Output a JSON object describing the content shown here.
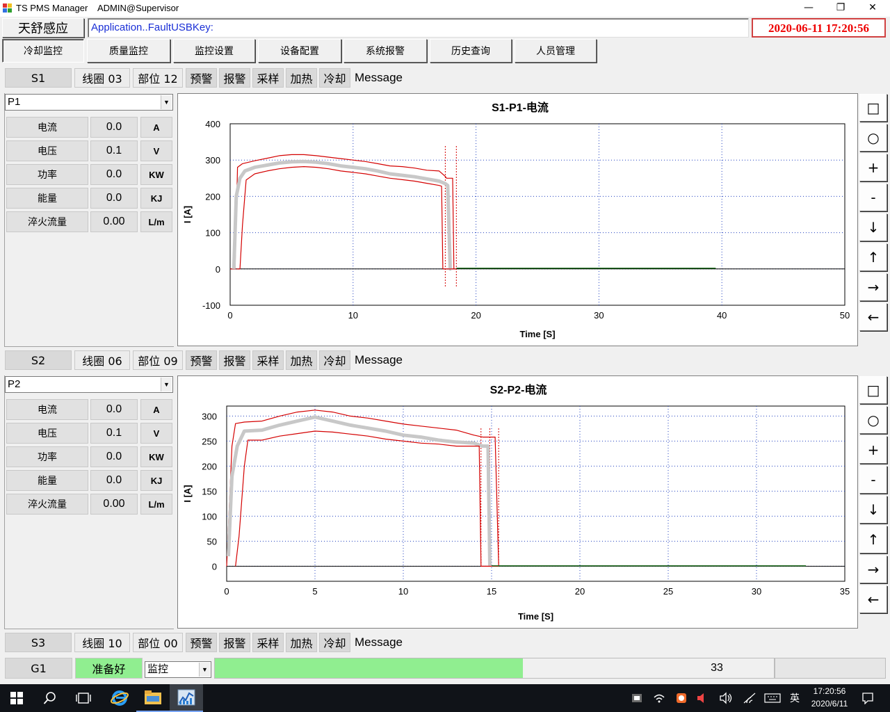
{
  "window": {
    "title": "TS PMS Manager",
    "user": "ADMIN@Supervisor",
    "minimize": "—",
    "maximize": "❐",
    "close": "✕"
  },
  "header": {
    "brand": "天舒感应",
    "status_text": "Application..FaultUSBKey:",
    "datetime": "2020-06-11 17:20:56"
  },
  "tabs": [
    {
      "label": "冷却监控",
      "active": true
    },
    {
      "label": "质量监控",
      "active": false
    },
    {
      "label": "监控设置",
      "active": false
    },
    {
      "label": "设备配置",
      "active": false
    },
    {
      "label": "系统报警",
      "active": false
    },
    {
      "label": "历史查询",
      "active": false
    },
    {
      "label": "人员管理",
      "active": false
    }
  ],
  "stations": [
    {
      "station": "S1",
      "coil": "线圈 03",
      "part": "部位 12",
      "flags": [
        "预警",
        "报警",
        "采样",
        "加热",
        "冷却"
      ],
      "message": "Message",
      "selected_point": "P1",
      "metrics": [
        {
          "label": "电流",
          "value": "0.0",
          "unit": "A"
        },
        {
          "label": "电压",
          "value": "0.1",
          "unit": "V"
        },
        {
          "label": "功率",
          "value": "0.0",
          "unit": "KW"
        },
        {
          "label": "能量",
          "value": "0.0",
          "unit": "KJ"
        },
        {
          "label": "淬火流量",
          "value": "0.00",
          "unit": "L/m"
        }
      ]
    },
    {
      "station": "S2",
      "coil": "线圈 06",
      "part": "部位 09",
      "flags": [
        "预警",
        "报警",
        "采样",
        "加热",
        "冷却"
      ],
      "message": "Message",
      "selected_point": "P2",
      "metrics": [
        {
          "label": "电流",
          "value": "0.0",
          "unit": "A"
        },
        {
          "label": "电压",
          "value": "0.1",
          "unit": "V"
        },
        {
          "label": "功率",
          "value": "0.0",
          "unit": "KW"
        },
        {
          "label": "能量",
          "value": "0.0",
          "unit": "KJ"
        },
        {
          "label": "淬火流量",
          "value": "0.00",
          "unit": "L/m"
        }
      ]
    },
    {
      "station": "S3",
      "coil": "线圈 10",
      "part": "部位 00",
      "flags": [
        "预警",
        "报警",
        "采样",
        "加热",
        "冷却"
      ],
      "message": "Message"
    }
  ],
  "chart_tools": [
    "□",
    "○",
    "+",
    "-",
    "↓",
    "↑",
    "→",
    "←"
  ],
  "chart_tool_icons": [
    "square-icon",
    "circle-icon",
    "plus-icon",
    "minus-icon",
    "arrow-down-icon",
    "arrow-up-icon",
    "arrow-right-icon",
    "arrow-left-icon"
  ],
  "colors": {
    "limit_line": "#d40000",
    "measured_line": "#c8c8c8",
    "zero_line": "#000000",
    "tail_line": "#1f6b1f",
    "grid": "#1f3fbf",
    "ready": "#90ee90",
    "status_text": "#1a2fd6",
    "clock": "#ee0000"
  },
  "chart_data": [
    {
      "type": "line",
      "title": "S1-P1-电流",
      "xlabel": "Time [S]",
      "ylabel": "I [A]",
      "xlim": [
        0,
        50
      ],
      "ylim": [
        -100,
        400
      ],
      "xticks": [
        0,
        10,
        20,
        30,
        40,
        50
      ],
      "yticks": [
        -100,
        0,
        100,
        200,
        300,
        400
      ],
      "grid": true,
      "markers_x": [
        17.5,
        18.4
      ],
      "series": [
        {
          "role": "upper-limit",
          "x": [
            0,
            0.4,
            0.6,
            1,
            2,
            3,
            4,
            5,
            6,
            7,
            8,
            9,
            10,
            11,
            12,
            13,
            14,
            15,
            16,
            17,
            17.5,
            17.6,
            18.1,
            18.2
          ],
          "y": [
            0,
            0,
            280,
            290,
            298,
            305,
            312,
            315,
            315,
            312,
            308,
            304,
            300,
            296,
            290,
            284,
            282,
            278,
            272,
            270,
            255,
            250,
            250,
            0
          ]
        },
        {
          "role": "measured",
          "x": [
            0.3,
            0.5,
            0.8,
            1.2,
            2,
            3,
            4,
            5,
            6,
            7,
            8,
            9,
            10,
            11,
            12,
            13,
            14,
            15,
            16,
            17,
            17.5,
            17.7,
            17.9,
            18.0
          ],
          "y": [
            0,
            200,
            250,
            270,
            280,
            286,
            292,
            295,
            296,
            294,
            290,
            284,
            280,
            276,
            270,
            262,
            258,
            254,
            248,
            242,
            235,
            230,
            0,
            0
          ]
        },
        {
          "role": "lower-limit",
          "x": [
            0.5,
            0.8,
            1.0,
            1.3,
            2,
            3,
            4,
            5,
            6,
            7,
            8,
            9,
            10,
            11,
            12,
            13,
            14,
            15,
            16,
            17,
            17.2,
            17.3,
            18.3,
            18.4
          ],
          "y": [
            0,
            0,
            120,
            245,
            262,
            270,
            276,
            280,
            282,
            280,
            276,
            270,
            266,
            262,
            256,
            250,
            246,
            242,
            236,
            230,
            228,
            0,
            0,
            0
          ]
        },
        {
          "role": "tail",
          "x": [
            18.4,
            39.5
          ],
          "y": [
            2,
            2
          ]
        }
      ]
    },
    {
      "type": "line",
      "title": "S2-P2-电流",
      "xlabel": "Time [S]",
      "ylabel": "I [A]",
      "xlim": [
        0,
        35
      ],
      "ylim": [
        -30,
        320
      ],
      "xticks": [
        0,
        5,
        10,
        15,
        20,
        25,
        30,
        35
      ],
      "yticks": [
        0,
        50,
        100,
        150,
        200,
        250,
        300
      ],
      "grid": true,
      "markers_x": [
        14.4,
        14.9,
        15.4
      ],
      "series": [
        {
          "role": "upper-limit",
          "x": [
            0,
            0.3,
            0.5,
            1,
            2,
            3,
            4,
            5,
            6,
            7,
            8,
            9,
            10,
            11,
            12,
            13,
            14,
            14.5,
            14.6,
            15.2,
            15.4
          ],
          "y": [
            0,
            240,
            285,
            288,
            290,
            300,
            308,
            312,
            308,
            300,
            296,
            290,
            284,
            280,
            276,
            272,
            262,
            258,
            258,
            258,
            0
          ]
        },
        {
          "role": "measured",
          "x": [
            0.1,
            0.3,
            0.6,
            1,
            2,
            3,
            4,
            5,
            6,
            7,
            8,
            9,
            10,
            11,
            12,
            13,
            14,
            14.5,
            14.8,
            14.9
          ],
          "y": [
            20,
            180,
            240,
            270,
            272,
            282,
            290,
            298,
            290,
            282,
            276,
            270,
            262,
            258,
            252,
            248,
            246,
            240,
            240,
            0
          ]
        },
        {
          "role": "lower-limit",
          "x": [
            0.5,
            0.7,
            1.0,
            1.2,
            2,
            3,
            4,
            5,
            6,
            7,
            8,
            9,
            10,
            11,
            12,
            13,
            14,
            14.3,
            14.4,
            15.4
          ],
          "y": [
            0,
            60,
            200,
            252,
            252,
            260,
            265,
            270,
            268,
            264,
            260,
            254,
            250,
            246,
            244,
            240,
            240,
            240,
            0,
            0
          ]
        },
        {
          "role": "tail",
          "x": [
            15.0,
            32.8
          ],
          "y": [
            1,
            1
          ]
        }
      ]
    }
  ],
  "group": {
    "name": "G1",
    "state": "准备好",
    "mode": "监控",
    "progress_fraction": 0.551,
    "progress_value": "33"
  },
  "taskbar": {
    "time": "17:20:56",
    "date": "2020/6/11",
    "ime": "英",
    "start": "⊞",
    "search": "⚲",
    "taskview": "❐"
  }
}
